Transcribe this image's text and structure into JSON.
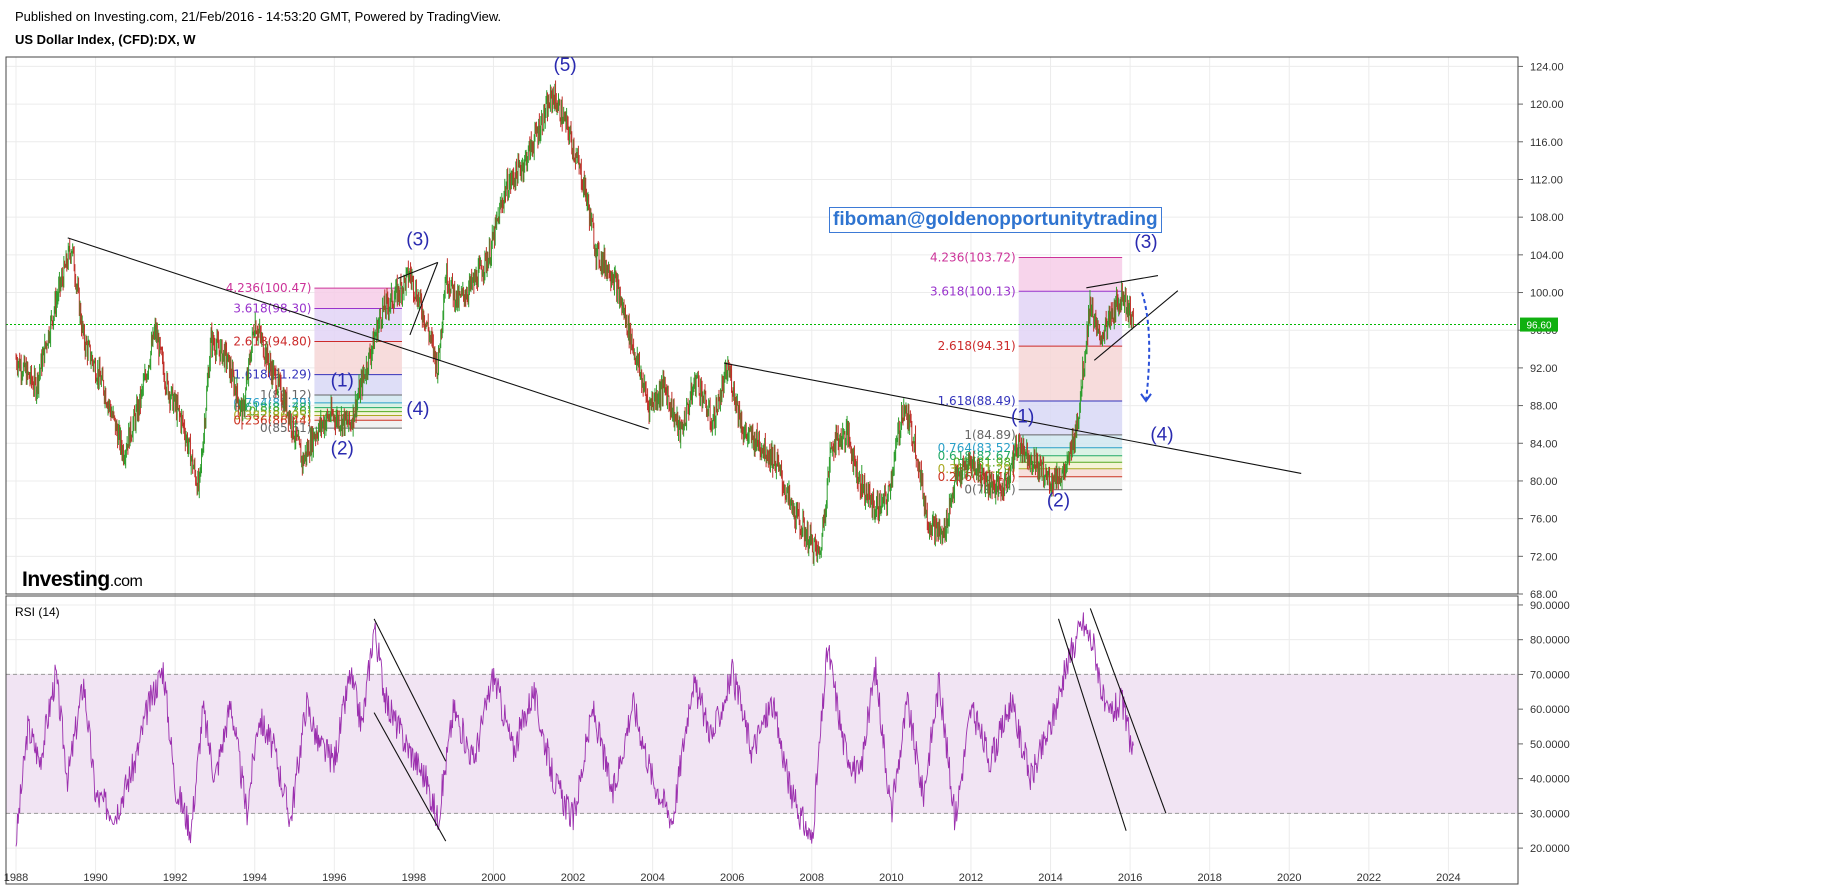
{
  "header": {
    "published": "Published on Investing.com, 21/Feb/2016 - 14:53:20 GMT, Powered by TradingView.",
    "title": "US Dollar Index, (CFD):DX, W"
  },
  "watermark": "fiboman@goldenopportunitytrading",
  "logo": {
    "main": "Investing",
    "suffix": ".com"
  },
  "rsi_label": "RSI (14)",
  "price_marker": "96.60",
  "colors": {
    "grid": "#ececec",
    "up": "#2e9e2e",
    "down": "#c0302a",
    "rsi": "#9b2fae",
    "rsi_band": "#f1e4f3",
    "wave": "#2a2ab0",
    "price_line": "#00b800",
    "trend": "#111111"
  },
  "chart_data": [
    {
      "type": "line",
      "title": "US Dollar Index, (CFD):DX, W",
      "xlim": [
        1988,
        2026
      ],
      "ylim": [
        68,
        125
      ],
      "xticks": [
        "1988",
        "1990",
        "1992",
        "1994",
        "1996",
        "1998",
        "2000",
        "2002",
        "2004",
        "2006",
        "2008",
        "2010",
        "2012",
        "2014",
        "2016",
        "2018",
        "2020",
        "2022",
        "2024"
      ],
      "yticks": [
        "68.00",
        "72.00",
        "76.00",
        "80.00",
        "84.00",
        "88.00",
        "92.00",
        "96.00",
        "100.00",
        "104.00",
        "108.00",
        "112.00",
        "116.00",
        "120.00",
        "124.00"
      ],
      "current_price": 96.6,
      "series": [
        {
          "x": [
            1988.0,
            1988.5,
            1989.0,
            1989.4,
            1989.7,
            1990.2,
            1990.7,
            1991.1,
            1991.5,
            1991.8,
            1992.2,
            1992.6,
            1992.9,
            1993.3,
            1993.7,
            1994.0,
            1994.4,
            1994.8,
            1995.2,
            1995.5,
            1995.9,
            1996.4,
            1996.8,
            1997.2,
            1997.6,
            1997.9,
            1998.3,
            1998.6,
            1998.8,
            1999.1,
            1999.5,
            1999.9,
            2000.3,
            2000.8,
            2001.2,
            2001.5,
            2001.9,
            2002.3,
            2002.6,
            2003.0,
            2003.4,
            2003.9,
            2004.3,
            2004.7,
            2005.1,
            2005.5,
            2005.9,
            2006.3,
            2006.7,
            2007.1,
            2007.5,
            2007.9,
            2008.2,
            2008.5,
            2008.9,
            2009.2,
            2009.6,
            2009.9,
            2010.3,
            2010.6,
            2010.9,
            2011.3,
            2011.6,
            2012.0,
            2012.4,
            2012.8,
            2013.2,
            2013.6,
            2014.0,
            2014.4,
            2014.7,
            2015.0,
            2015.2,
            2015.5,
            2015.8,
            2016.1
          ],
          "values": [
            93,
            90,
            99,
            105,
            95,
            90,
            83,
            88,
            96,
            90,
            86,
            79,
            95,
            93,
            87,
            97,
            92,
            88,
            82,
            85,
            87,
            86,
            92,
            98,
            100,
            102,
            97,
            92,
            102,
            99,
            101,
            104,
            111,
            114,
            118,
            121,
            117,
            111,
            104,
            102,
            96,
            88,
            90,
            85,
            91,
            86,
            92,
            85,
            84,
            82,
            77,
            74,
            72,
            84,
            85,
            80,
            77,
            78,
            88,
            84,
            76,
            74,
            80,
            82,
            80,
            79,
            84,
            82,
            80,
            81,
            87,
            99,
            95,
            97,
            100,
            96.6
          ]
        }
      ]
    },
    {
      "type": "line",
      "title": "RSI (14)",
      "ylim": [
        16,
        92
      ],
      "yticks": [
        "20.0000",
        "30.0000",
        "40.0000",
        "50.0000",
        "60.0000",
        "70.0000",
        "80.0000",
        "90.0000"
      ],
      "band": [
        30,
        70
      ],
      "series": [
        {
          "x": [
            1988.0,
            1988.3,
            1988.6,
            1989.0,
            1989.3,
            1989.7,
            1990.0,
            1990.5,
            1991.0,
            1991.3,
            1991.7,
            1992.0,
            1992.4,
            1992.7,
            1993.0,
            1993.4,
            1993.8,
            1994.1,
            1994.5,
            1994.9,
            1995.3,
            1995.6,
            1996.0,
            1996.4,
            1996.7,
            1997.0,
            1997.3,
            1997.8,
            1998.3,
            1998.6,
            1999.0,
            1999.5,
            2000.0,
            2000.5,
            2001.0,
            2001.5,
            2002.0,
            2002.5,
            2003.0,
            2003.5,
            2004.0,
            2004.5,
            2005.0,
            2005.5,
            2006.0,
            2006.5,
            2007.0,
            2007.5,
            2008.0,
            2008.4,
            2008.8,
            2009.2,
            2009.6,
            2010.0,
            2010.4,
            2010.8,
            2011.2,
            2011.6,
            2012.0,
            2012.5,
            2013.0,
            2013.5,
            2014.0,
            2014.4,
            2014.8,
            2015.1,
            2015.4,
            2015.8,
            2016.1
          ],
          "values": [
            22,
            55,
            45,
            70,
            40,
            68,
            35,
            30,
            45,
            60,
            72,
            38,
            25,
            60,
            40,
            62,
            30,
            58,
            48,
            28,
            62,
            50,
            45,
            70,
            55,
            84,
            62,
            50,
            40,
            28,
            60,
            45,
            70,
            48,
            65,
            40,
            28,
            60,
            35,
            62,
            40,
            28,
            68,
            52,
            70,
            48,
            62,
            35,
            22,
            78,
            50,
            40,
            72,
            30,
            62,
            35,
            68,
            28,
            60,
            45,
            62,
            40,
            55,
            72,
            85,
            78,
            58,
            62,
            45
          ]
        }
      ]
    }
  ],
  "fib_left": [
    {
      "label": "4.236(100.47)",
      "value": 100.47,
      "color": "#cc3399"
    },
    {
      "label": "3.618(98.30)",
      "value": 98.3,
      "color": "#9933cc"
    },
    {
      "label": "2.618(94.80)",
      "value": 94.8,
      "color": "#cc2a2a"
    },
    {
      "label": "1.618(91.29)",
      "value": 91.29,
      "color": "#3333bb"
    },
    {
      "label": "1(89.12)",
      "value": 89.12,
      "color": "#666666"
    },
    {
      "label": "0.764(88.29)",
      "value": 88.29,
      "color": "#2aa0c8"
    },
    {
      "label": "0.618(87.78)",
      "value": 87.78,
      "color": "#22aa66"
    },
    {
      "label": "0.5(87.36)",
      "value": 87.36,
      "color": "#55aa22"
    },
    {
      "label": "0.382(86.95)",
      "value": 86.95,
      "color": "#aaaa22"
    },
    {
      "label": "0.236(86.44)",
      "value": 86.44,
      "color": "#cc3322"
    },
    {
      "label": "0(85.61)",
      "value": 85.61,
      "color": "#666666"
    }
  ],
  "fib_right": [
    {
      "label": "4.236(103.72)",
      "value": 103.72,
      "color": "#cc3399"
    },
    {
      "label": "3.618(100.13)",
      "value": 100.13,
      "color": "#9933cc"
    },
    {
      "label": "2.618(94.31)",
      "value": 94.31,
      "color": "#cc2a2a"
    },
    {
      "label": "1.618(88.49)",
      "value": 88.49,
      "color": "#3333bb"
    },
    {
      "label": "1(84.89)",
      "value": 84.89,
      "color": "#666666"
    },
    {
      "label": "0.764(83.52)",
      "value": 83.52,
      "color": "#2aa0c8"
    },
    {
      "label": "0.618(82.67)",
      "value": 82.67,
      "color": "#22aa66"
    },
    {
      "label": "0.5(81.98)",
      "value": 81.98,
      "color": "#55aa22"
    },
    {
      "label": "0.382(81.29)",
      "value": 81.29,
      "color": "#aaaa22"
    },
    {
      "label": "0.236(80.44)",
      "value": 80.44,
      "color": "#cc3322"
    },
    {
      "label": "0(79.07)",
      "value": 79.07,
      "color": "#666666"
    }
  ],
  "waves": [
    {
      "label": "(1)",
      "x": 1996.2,
      "y": 90.0
    },
    {
      "label": "(2)",
      "x": 1996.2,
      "y": 82.8
    },
    {
      "label": "(3)",
      "x": 1998.1,
      "y": 105.0
    },
    {
      "label": "(4)",
      "x": 1998.1,
      "y": 87.0
    },
    {
      "label": "(5)",
      "x": 2001.8,
      "y": 123.5
    },
    {
      "label": "(1)",
      "x": 2013.3,
      "y": 86.2
    },
    {
      "label": "(2)",
      "x": 2014.2,
      "y": 77.3
    },
    {
      "label": "(3)",
      "x": 2016.4,
      "y": 104.7
    },
    {
      "label": "(4)",
      "x": 2016.8,
      "y": 84.3
    }
  ]
}
